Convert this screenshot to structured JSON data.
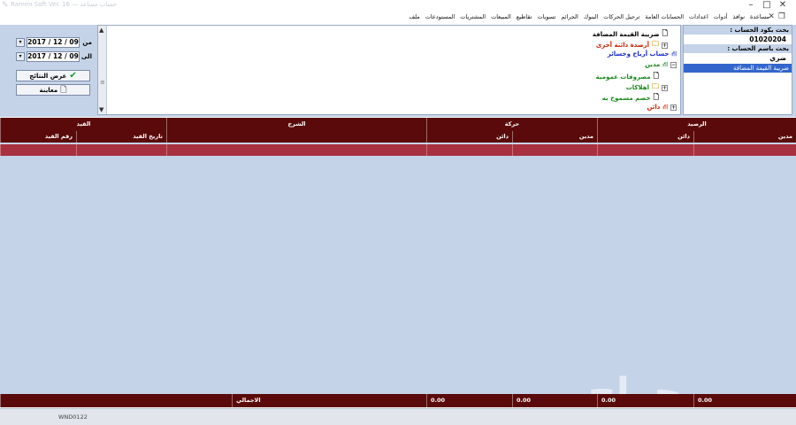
{
  "window": {
    "faded_title": "Ramen Soft Ver. 16 — حساب مساعد",
    "buttons": {
      "minimize": "–",
      "maximize": "□",
      "close": "✕"
    }
  },
  "menu": {
    "items": [
      "ملف",
      "المستودعات",
      "المشتريات",
      "المبيعات",
      "تقاطيع",
      "تسويات",
      "الجرائم",
      "البنوك",
      "ترحيل الحركات",
      "الحسابات العامة",
      "اعدادات",
      "أدوات",
      "نوافذ",
      "مساعدة"
    ]
  },
  "account_search": {
    "by_code_label": "بحث بكود الحساب :",
    "code_value": "01020204",
    "by_name_label": "بحث باسم الحساب :",
    "name_value": "ضري",
    "selected_result": "ضريبة القيمة المضافة"
  },
  "tree": {
    "items": [
      {
        "label": "ضريبة القيمة المضافة",
        "color": "#000000"
      },
      {
        "label": "أرصدة دائنة أخرى",
        "color": "#cc2200"
      },
      {
        "label": "حساب أرباح وخسائر",
        "color": "#1a2acc"
      },
      {
        "label": "مدين",
        "color": "#1a8a1a"
      },
      {
        "label": "مصروفات عمومية",
        "color": "#1a8a1a"
      },
      {
        "label": "اهلاكات",
        "color": "#1a8a1a"
      },
      {
        "label": "خصم مسموح به",
        "color": "#1a8a1a"
      },
      {
        "label": "دائن",
        "color": "#cc2200"
      }
    ]
  },
  "dates": {
    "from_label": "من",
    "from_value": "2017 / 12 / 09",
    "to_label": "الى",
    "to_value": "2017 / 12 / 09"
  },
  "buttons": {
    "show_results": "عرض النتائج",
    "preview": "معاينة"
  },
  "grid": {
    "header_groups": [
      "الرصيد",
      "حركة",
      "الشرح",
      "القيد"
    ],
    "columns": [
      "مدين",
      "دائن",
      "مدين",
      "دائن",
      "",
      "تاريخ القيد",
      "رقم القيد"
    ]
  },
  "totals": {
    "values": [
      "0.00",
      "0.00",
      "0.00",
      "0.00"
    ],
    "label": "الاجمالي"
  },
  "status": {
    "code": "WND0122"
  },
  "watermark": "حراج"
}
